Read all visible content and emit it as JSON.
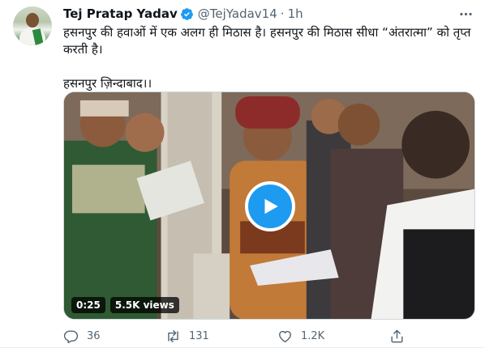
{
  "tweet": {
    "author_name": "Tej Pratap Yadav",
    "handle": "@TejYadav14",
    "separator": "·",
    "time": "1h",
    "text_line1": "हसनपुर की हवाओं में एक अलग ही मिठास है। हसनपुर की मिठास सीधा “अंतरात्मा” को तृप्त करती है।",
    "text_line2": "हसनपुर ज़िन्दाबाद।।"
  },
  "video": {
    "duration": "0:25",
    "views": "5.5K views"
  },
  "actions": {
    "replies": "36",
    "retweets": "131",
    "likes": "1.2K"
  },
  "colors": {
    "accent": "#1d9bf0",
    "secondary_text": "#536471"
  },
  "icons": {
    "verified": "verified-badge-icon",
    "more": "more-options-icon",
    "play": "play-icon",
    "reply": "reply-icon",
    "retweet": "retweet-icon",
    "like": "like-icon",
    "share": "share-icon"
  }
}
